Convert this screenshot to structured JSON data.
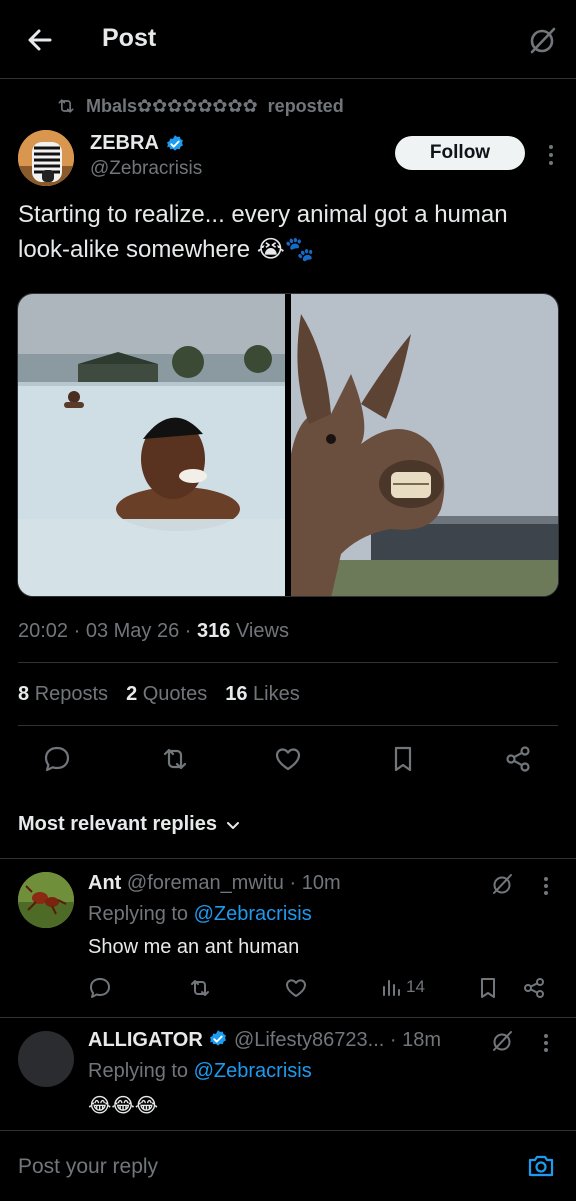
{
  "header": {
    "title": "Post"
  },
  "repost": {
    "user": "Mbals✿✿✿✿✿✿✿✿",
    "label": "reposted"
  },
  "author": {
    "name": "ZEBRA",
    "handle": "@Zebracrisis",
    "follow_label": "Follow"
  },
  "post": {
    "text": "Starting to realize... every animal got a human look-alike somewhere",
    "text_emoji": "😭🐾",
    "time": "20:02",
    "date": "03 May 26",
    "views_count": "316",
    "views_label": "Views",
    "reposts_count": "8",
    "reposts_label": "Reposts",
    "quotes_count": "2",
    "quotes_label": "Quotes",
    "likes_count": "16",
    "likes_label": "Likes"
  },
  "replies_section": {
    "title": "Most relevant replies"
  },
  "replies": [
    {
      "name": "Ant",
      "handle": "@foreman_mwitu",
      "time": "10m",
      "replying_label": "Replying to",
      "replying_handle": "@Zebracrisis",
      "text": "Show me an ant human",
      "views": "14"
    },
    {
      "name": "ALLIGATOR",
      "handle": "@Lifesty86723...",
      "time": "18m",
      "replying_label": "Replying to",
      "replying_handle": "@Zebracrisis",
      "text": "😂😂😂"
    }
  ],
  "compose": {
    "placeholder": "Post your reply"
  },
  "colors": {
    "accent": "#1d9bf0",
    "background": "#000000",
    "muted": "#71767b",
    "divider": "#2f3336"
  },
  "icons": [
    "back-arrow-icon",
    "grok-icon",
    "repost-icon",
    "verified-badge-icon",
    "more-icon",
    "reply-icon",
    "like-icon",
    "bookmark-icon",
    "share-icon",
    "views-icon",
    "chevron-down-icon",
    "camera-icon"
  ]
}
